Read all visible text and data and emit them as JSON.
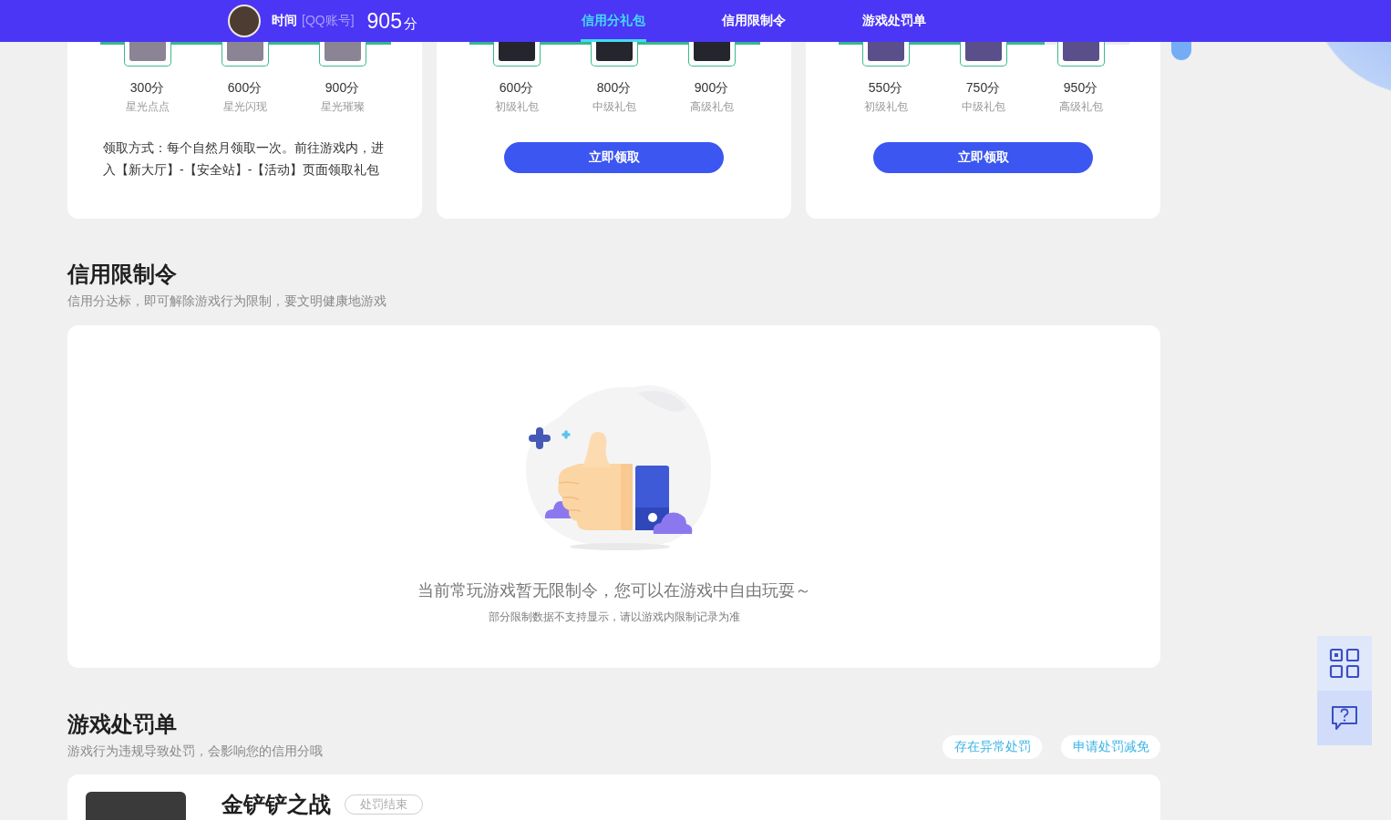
{
  "top_bar": {
    "user": {
      "name": "时间",
      "account": "[QQ账号]",
      "score": "905",
      "unit": "分"
    },
    "tabs": [
      {
        "label": "信用分礼包",
        "selected": true
      },
      {
        "label": "信用限制令",
        "selected": false
      },
      {
        "label": "游戏处罚单",
        "selected": false
      }
    ]
  },
  "gift_cards": [
    {
      "progress": {
        "level": 1
      },
      "items": [
        {
          "points": "300分",
          "name": "星光点点"
        },
        {
          "points": "600分",
          "name": "星光闪现"
        },
        {
          "points": "900分",
          "name": "星光璀璨"
        }
      ],
      "kind": "note",
      "note": "领取方式：每个自然月领取一次。前往游戏内，进入【新大厅】-【安全站】-【活动】页面领取礼包"
    },
    {
      "progress": {
        "level": 1
      },
      "items": [
        {
          "points": "600分",
          "name": "初级礼包"
        },
        {
          "points": "800分",
          "name": "中级礼包"
        },
        {
          "points": "900分",
          "name": "高级礼包"
        }
      ],
      "kind": "button",
      "button": "立即领取"
    },
    {
      "progress": {
        "level": 0.71
      },
      "items": [
        {
          "points": "550分",
          "name": "初级礼包"
        },
        {
          "points": "750分",
          "name": "中级礼包"
        },
        {
          "points": "950分",
          "name": "高级礼包"
        }
      ],
      "kind": "button",
      "button": "立即领取"
    }
  ],
  "restriction_section": {
    "title": "信用限制令",
    "subtitle": "信用分达标，即可解除游戏行为限制，要文明健康地游戏",
    "empty_state": {
      "message": "当前常玩游戏暂无限制令，您可以在游戏中自由玩耍～",
      "note": "部分限制数据不支持显示，请以游戏内限制记录为准"
    }
  },
  "penalty_section": {
    "title": "游戏处罚单",
    "subtitle": "游戏行为违规导致处罚，会影响您的信用分哦",
    "actions": [
      "存在异常处罚",
      "申请处罚减免"
    ],
    "records": [
      {
        "game": "金铲铲之战",
        "status": "处罚结束"
      }
    ]
  }
}
